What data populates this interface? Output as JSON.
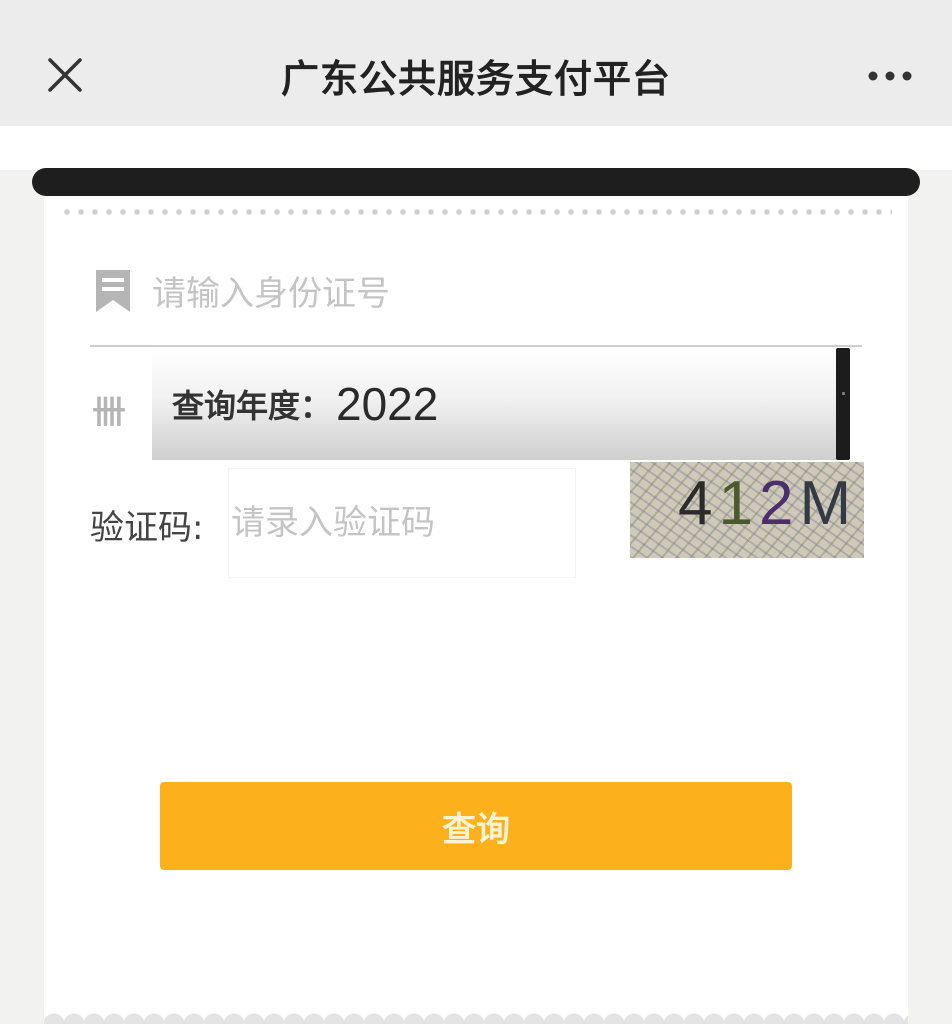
{
  "header": {
    "title": "广东公共服务支付平台",
    "close_icon": "close-icon",
    "more_icon": "more-icon"
  },
  "form": {
    "id_field": {
      "placeholder": "请输入身份证号",
      "icon": "bookmark-icon"
    },
    "year_field": {
      "icon_text": "卌",
      "label": "查询年度：",
      "value": "2022"
    },
    "captcha_field": {
      "label": "验证码:",
      "placeholder": "请录入验证码",
      "image_text": [
        "4",
        "1",
        "2",
        "M"
      ]
    },
    "submit_label": "查询"
  },
  "colors": {
    "accent": "#fcb01c",
    "header_bg": "#ececec",
    "page_bg": "#f2f2f0"
  }
}
